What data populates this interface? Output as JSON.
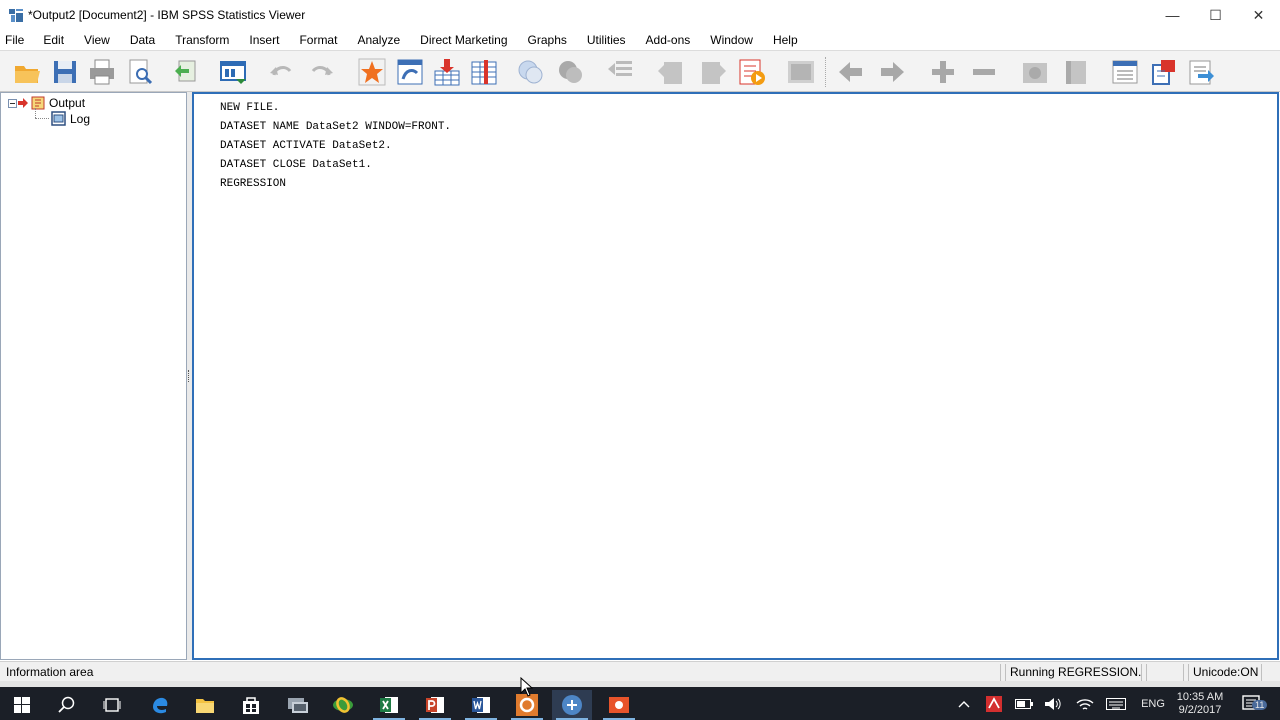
{
  "window": {
    "title": "*Output2 [Document2] - IBM SPSS Statistics Viewer",
    "minimize": "—",
    "maximize": "☐",
    "close": "✕"
  },
  "menu": [
    "File",
    "Edit",
    "View",
    "Data",
    "Transform",
    "Insert",
    "Format",
    "Analyze",
    "Direct Marketing",
    "Graphs",
    "Utilities",
    "Add-ons",
    "Window",
    "Help"
  ],
  "toolbar": {
    "icons": [
      "open-icon",
      "save-icon",
      "print-icon",
      "print-preview-icon",
      "export-icon",
      "recall-dialog-icon",
      "undo-icon",
      "redo-icon",
      "go-to-case-icon",
      "go-to-variable-icon",
      "insert-cases-icon",
      "variables-icon",
      "show-chart-icon",
      "hide-chart-icon",
      "designate-window-icon",
      "promote-icon",
      "demote-icon",
      "run-script-icon",
      "select-last-output-icon",
      "back-icon",
      "forward-icon",
      "expand-icon",
      "collapse-icon",
      "show-icon",
      "hide-icon",
      "insert-heading-icon",
      "insert-title-icon",
      "insert-text-icon"
    ]
  },
  "outline": {
    "root": "Output",
    "child": "Log"
  },
  "log": {
    "lines": [
      "NEW FILE.",
      "DATASET NAME DataSet2 WINDOW=FRONT.",
      "DATASET ACTIVATE DataSet2.",
      "DATASET CLOSE DataSet1.",
      "REGRESSION"
    ]
  },
  "status": {
    "info": "Information area",
    "running": "Running REGRESSION...",
    "unicode": "Unicode:ON"
  },
  "taskbar": {
    "apps": [
      "start-icon",
      "search-icon",
      "task-view-icon",
      "edge-icon",
      "file-explorer-icon",
      "store-icon",
      "desktop-app-icon",
      "browser-icon",
      "excel-icon",
      "powerpoint-icon",
      "word-icon",
      "camtasia-icon",
      "spss-icon",
      "recorder-icon"
    ],
    "lang": "ENG",
    "time": "10:35 AM",
    "date": "9/2/2017",
    "notifications": "11"
  }
}
